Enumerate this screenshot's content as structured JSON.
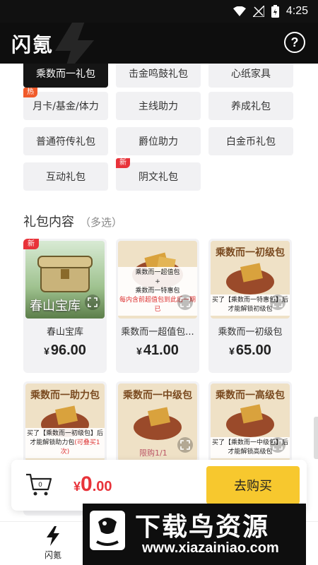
{
  "status": {
    "time": "4:25"
  },
  "app": {
    "logo": "闪氪",
    "help_icon": "?"
  },
  "categories": [
    {
      "label": "乘数而一礼包",
      "active": true,
      "tag": ""
    },
    {
      "label": "击金鸣鼓礼包",
      "active": false,
      "tag": ""
    },
    {
      "label": "心纸家具",
      "active": false,
      "tag": ""
    },
    {
      "label": "月卡/基金/体力",
      "active": false,
      "tag": "热"
    },
    {
      "label": "主线助力",
      "active": false,
      "tag": ""
    },
    {
      "label": "养成礼包",
      "active": false,
      "tag": ""
    },
    {
      "label": "普通符传礼包",
      "active": false,
      "tag": ""
    },
    {
      "label": "爵位助力",
      "active": false,
      "tag": ""
    },
    {
      "label": "白金币礼包",
      "active": false,
      "tag": ""
    },
    {
      "label": "互动礼包",
      "active": false,
      "tag": ""
    },
    {
      "label": "阴文礼包",
      "active": false,
      "tag": "新"
    }
  ],
  "section": {
    "title": "礼包内容",
    "subtitle": "（多选）"
  },
  "products": [
    {
      "name": "春山宝库",
      "price": "96.00",
      "yen": "¥",
      "new_tag": "新",
      "thumb_title": "",
      "image_text": "春山宝库",
      "caption": []
    },
    {
      "name": "乘数而一超值包...",
      "price": "41.00",
      "yen": "¥",
      "new_tag": "",
      "thumb_title": "",
      "image_text": "",
      "caption": [
        "乘数而一超值包",
        "+",
        "乘数而一特惠包",
        "每内含前超值包到此后一期已"
      ]
    },
    {
      "name": "乘数而一初级包",
      "price": "65.00",
      "yen": "¥",
      "new_tag": "",
      "thumb_title": "乘数而一初级包",
      "image_text": "",
      "caption": [
        "买了【乘数而一特惠包】后",
        "才能解锁初级包"
      ]
    },
    {
      "name": "",
      "price": "",
      "yen": "",
      "new_tag": "",
      "thumb_title": "乘数而一助力包",
      "image_text": "",
      "caption": [
        "买了【乘数而一初级包】后",
        "才能解锁助力包",
        "(可叠买1次)"
      ]
    },
    {
      "name": "",
      "price": "",
      "yen": "",
      "new_tag": "",
      "thumb_title": "乘数而一中级包",
      "image_text": "限购1/1",
      "caption": []
    },
    {
      "name": "",
      "price": "",
      "yen": "",
      "new_tag": "",
      "thumb_title": "乘数而一高级包",
      "image_text": "",
      "caption": [
        "买了【乘数而一中级包】后",
        "才能解锁高级包"
      ]
    }
  ],
  "cart": {
    "yen": "¥",
    "total_int": "0",
    "total_dec": ".00",
    "buy_label": "去购买"
  },
  "bottom_nav": [
    {
      "label": "闪氪",
      "icon": "bolt-icon"
    }
  ],
  "watermark": {
    "title": "下载鸟资源",
    "url": "www.xiazainiao.com"
  },
  "colors": {
    "accent": "#f7c82e",
    "price_red": "#e8333a",
    "dark": "#0e0e0e"
  }
}
